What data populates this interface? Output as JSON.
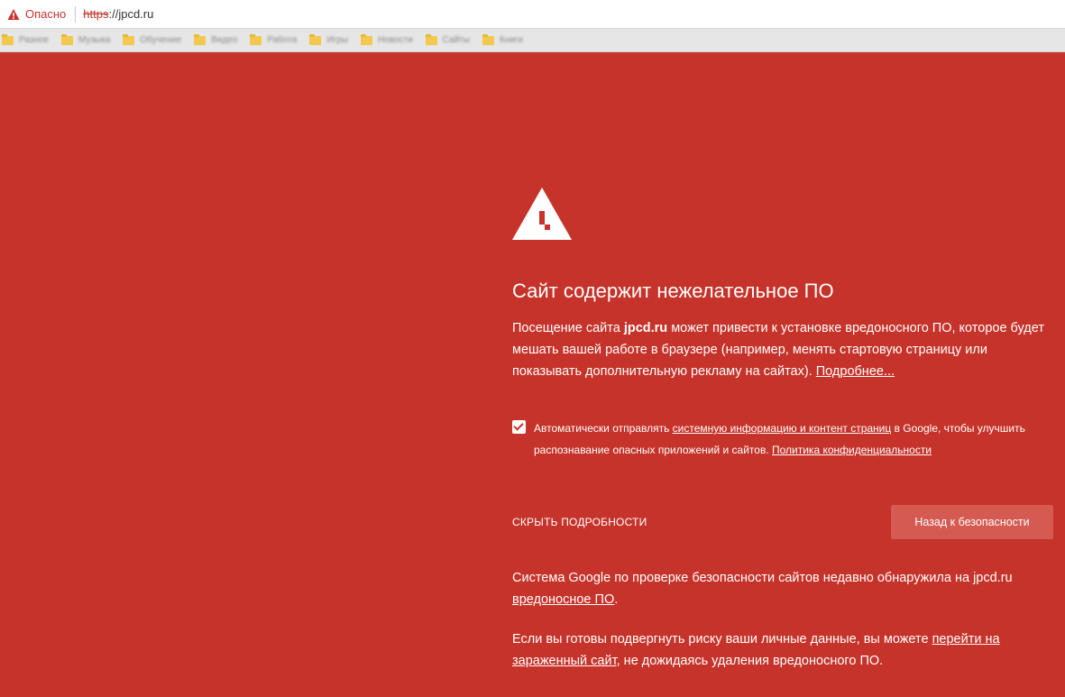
{
  "addressbar": {
    "danger_label": "Опасно",
    "url_scheme": "https",
    "url_rest": "://jpcd.ru"
  },
  "bookmarks": [
    {
      "label": "Разное"
    },
    {
      "label": "Музыка"
    },
    {
      "label": "Обучение"
    },
    {
      "label": "Видео"
    },
    {
      "label": "Работа"
    },
    {
      "label": "Игры"
    },
    {
      "label": "Новости"
    },
    {
      "label": "Сайты"
    },
    {
      "label": "Книги"
    }
  ],
  "warning": {
    "title": "Сайт содержит нежелательное ПО",
    "intro_before": "Посещение сайта ",
    "intro_domain": "jpcd.ru",
    "intro_after": " может привести к установке вредоносного ПО, которое будет мешать вашей работе в браузере (например, менять стартовую страницу или показывать дополнительную рекламу на сайтах). ",
    "more_link": "Подробнее...",
    "checkbox": {
      "checked": true,
      "text_before": "Автоматически отправлять ",
      "link1": "системную информацию и контент страниц",
      "text_middle": " в Google, чтобы улучшить распознавание опасных приложений и сайтов. ",
      "link2": "Политика конфиденциальности"
    },
    "hide_details": "СКРЫТЬ ПОДРОБНОСТИ",
    "back_button": "Назад к безопасности",
    "details1_before": "Система Google по проверке безопасности сайтов недавно обнаружила на jpcd.ru ",
    "details1_link": "вредоносное ПО",
    "details1_after": ".",
    "details2_before": "Если вы готовы подвергнуть риску ваши личные данные, вы можете ",
    "details2_link": "перейти на зараженный сайт",
    "details2_after": ", не дожидаясь удаления вредоносного ПО."
  },
  "colors": {
    "background": "#c5332a",
    "danger_text": "#c5332a",
    "button_bg": "#d45a52"
  },
  "icons": {
    "address_warning": "warning-triangle-icon",
    "page_warning": "warning-triangle-icon",
    "bookmark": "folder-icon"
  }
}
